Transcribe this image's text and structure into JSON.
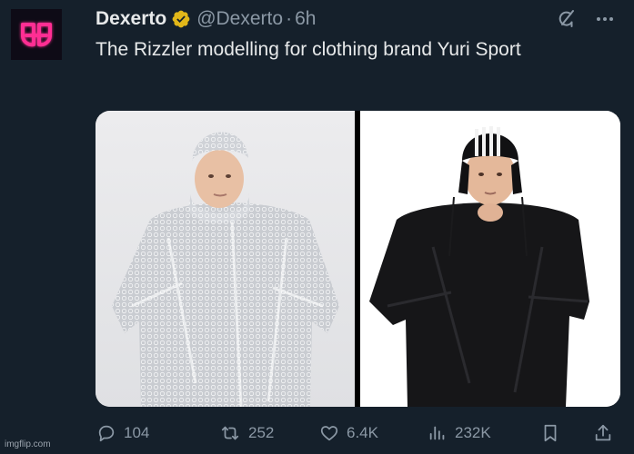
{
  "post": {
    "author": {
      "display_name": "Dexerto",
      "handle": "@Dexerto",
      "verified": true,
      "avatar_icon": "dexerto-logo"
    },
    "separator": "·",
    "timestamp": "6h",
    "text": "The Rizzler modelling for clothing brand Yuri Sport",
    "media_count": 2
  },
  "header_icons": [
    "grok-icon",
    "more-icon"
  ],
  "actions": {
    "replies": "104",
    "reposts": "252",
    "likes": "6.4K",
    "views": "232K"
  },
  "watermark": "imgflip.com",
  "colors": {
    "background": "#15202b",
    "primary_text": "#e7e9ea",
    "secondary_text": "#8b98a5",
    "verified_badge": "#e2b719",
    "logo_pink": "#ff2e93"
  }
}
